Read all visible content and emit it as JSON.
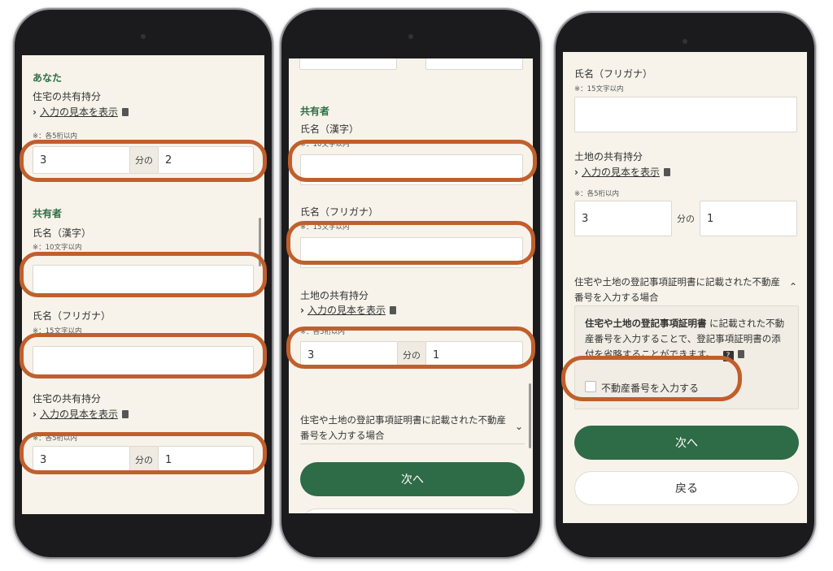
{
  "phone1": {
    "you_heading": "あなた",
    "house_share_label": "住宅の共有持分",
    "sample_link": "入力の見本を表示",
    "digits_note": "※：各5桁以内",
    "you_denominator": "3",
    "fraction_word": "分の",
    "you_numerator": "2",
    "co_owner_heading": "共有者",
    "name_kanji_label": "氏名（漢字）",
    "name_kanji_note": "※：10文字以内",
    "name_kana_label": "氏名（フリガナ）",
    "name_kana_note": "※：15文字以内",
    "co_house_share_label": "住宅の共有持分",
    "co_sample_link": "入力の見本を表示",
    "co_digits_note": "※：各5桁以内",
    "co_denominator": "3",
    "co_fraction_word": "分の",
    "co_numerator": "1"
  },
  "phone2": {
    "co_owner_heading": "共有者",
    "name_kanji_label": "氏名（漢字）",
    "name_kanji_note": "※：10文字以内",
    "name_kana_label": "氏名（フリガナ）",
    "name_kana_note": "※：15文字以内",
    "land_share_label": "土地の共有持分",
    "sample_link": "入力の見本を表示",
    "digits_note": "※：各5桁以内",
    "denominator": "3",
    "fraction_word": "分の",
    "numerator": "1",
    "accordion_text": "住宅や土地の登記事項証明書に記載された不動産番号を入力する場合",
    "next_button": "次へ"
  },
  "phone3": {
    "name_kana_label": "氏名（フリガナ）",
    "name_kana_note": "※：15文字以内",
    "land_share_label": "土地の共有持分",
    "sample_link": "入力の見本を表示",
    "digits_note": "※：各5桁以内",
    "denominator": "3",
    "fraction_word": "分の",
    "numerator": "1",
    "accordion_text": "住宅や土地の登記事項証明書に記載された不動産番号を入力する場合",
    "info_bold": "住宅や土地の登記事項証明書",
    "info_rest": "に記載された不動産番号を入力することで、登記事項証明書の添付を省略することができます。",
    "help_mark": "?",
    "checkbox_label": "不動産番号を入力する",
    "next_button": "次へ",
    "back_button": "戻る"
  },
  "colors": {
    "accent_green": "#2e6b47",
    "highlight_ring": "#c15f2c",
    "screen_bg": "#f7f3ea"
  },
  "icons": [
    "chevron-right-icon",
    "book-icon",
    "chevron-down-icon",
    "chevron-up-icon",
    "help-icon",
    "external-icon"
  ]
}
